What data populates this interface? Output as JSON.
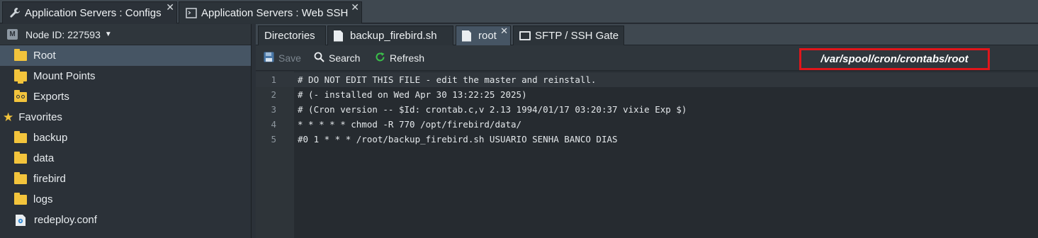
{
  "window_tabs": [
    {
      "label": "Application Servers : Configs",
      "icon": "wrench-icon",
      "active": true
    },
    {
      "label": "Application Servers : Web SSH",
      "icon": "terminal-icon",
      "active": false
    }
  ],
  "sidebar": {
    "node_label": "Node ID: 227593",
    "items": [
      {
        "label": "Root",
        "icon": "folder-icon",
        "selected": true
      },
      {
        "label": "Mount Points",
        "icon": "mount-folder-icon"
      },
      {
        "label": "Exports",
        "icon": "exports-icon"
      }
    ],
    "favorites_label": "Favorites",
    "favorites": [
      {
        "label": "backup",
        "icon": "folder-icon"
      },
      {
        "label": "data",
        "icon": "folder-icon"
      },
      {
        "label": "firebird",
        "icon": "folder-icon"
      },
      {
        "label": "logs",
        "icon": "folder-icon"
      },
      {
        "label": "redeploy.conf",
        "icon": "config-file-icon"
      }
    ]
  },
  "editor_tabs": [
    {
      "label": "Directories"
    },
    {
      "label": "backup_firebird.sh"
    },
    {
      "label": "root",
      "active": true
    },
    {
      "label": "SFTP / SSH Gate"
    }
  ],
  "toolbar": {
    "save_label": "Save",
    "search_label": "Search",
    "refresh_label": "Refresh",
    "path": "/var/spool/cron/crontabs/root"
  },
  "editor": {
    "lines": [
      {
        "num": "1",
        "text": "# DO NOT EDIT THIS FILE - edit the master and reinstall."
      },
      {
        "num": "2",
        "text": "# (- installed on Wed Apr 30 13:22:25 2025)"
      },
      {
        "num": "3",
        "text": "# (Cron version -- $Id: crontab.c,v 2.13 1994/01/17 03:20:37 vixie Exp $)"
      },
      {
        "num": "4",
        "text": "* * * * * chmod -R 770 /opt/firebird/data/"
      },
      {
        "num": "5",
        "text": "#0 1 * * * /root/backup_firebird.sh USUARIO SENHA BANCO DIAS"
      }
    ]
  },
  "colors": {
    "accent_highlight": "#e0161b",
    "folder": "#f3c43c",
    "selection": "#465564"
  }
}
